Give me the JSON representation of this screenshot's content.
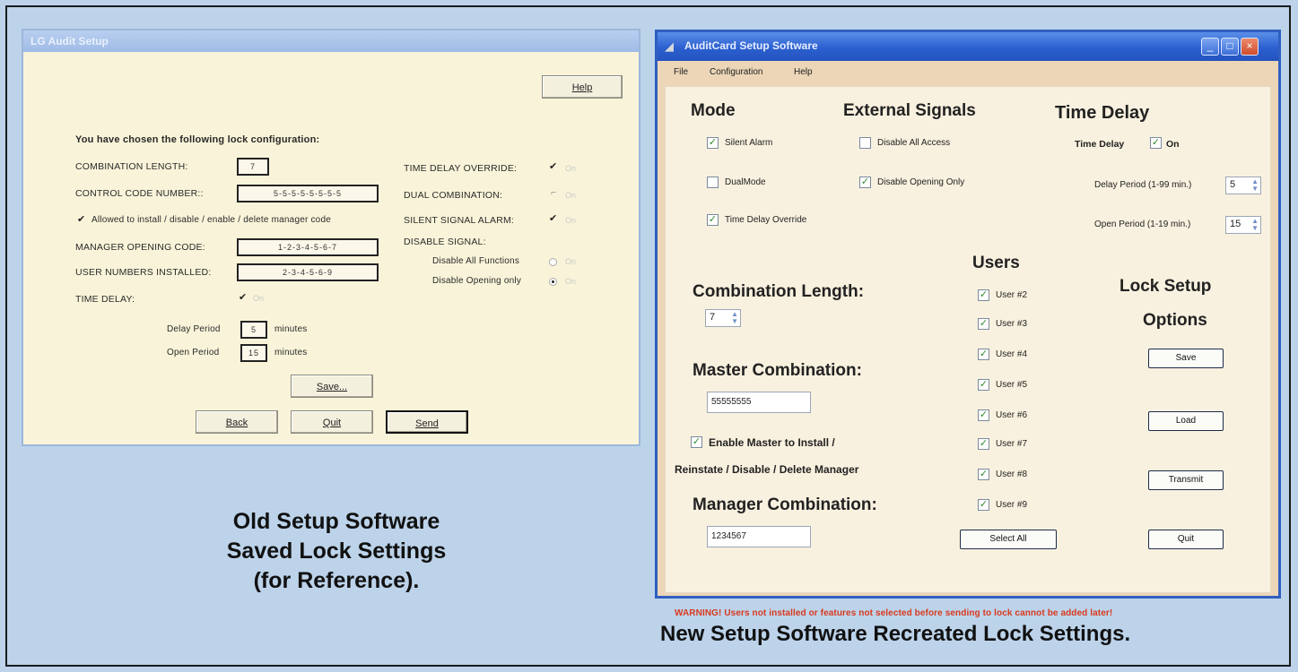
{
  "old": {
    "title": "LG Audit Setup",
    "help": "Help",
    "heading": "You have chosen the following lock configuration:",
    "combination_length_label": "COMBINATION LENGTH:",
    "combination_length": "7",
    "control_code_label": "CONTROL CODE NUMBER::",
    "control_code": "5-5-5-5-5-5-5-5",
    "allowed_label": "Allowed to install / disable / enable / delete manager code",
    "manager_code_label": "MANAGER OPENING CODE:",
    "manager_code": "1-2-3-4-5-6-7",
    "users_label": "USER NUMBERS INSTALLED:",
    "users": "2-3-4-5-6-9",
    "time_delay_label": "TIME DELAY:",
    "on_word": "On",
    "delay_period_label": "Delay Period",
    "delay_period": "5",
    "open_period_label": "Open Period",
    "open_period": "15",
    "minutes": "minutes",
    "tdo_label": "TIME DELAY OVERRIDE:",
    "dual_label": "DUAL COMBINATION:",
    "silent_label": "SILENT SIGNAL ALARM:",
    "disable_signal_label": "DISABLE SIGNAL:",
    "disable_all_label": "Disable All Functions",
    "disable_opening_label": "Disable Opening only",
    "save": "Save...",
    "back": "Back",
    "quit": "Quit",
    "send": "Send",
    "checkmark": "✔"
  },
  "caption_old": [
    "Old Setup Software",
    "Saved Lock Settings",
    "(for Reference)."
  ],
  "new": {
    "title": "AuditCard Setup Software",
    "menu": [
      "File",
      "Configuration",
      "Help"
    ],
    "mode_heading": "Mode",
    "external_heading": "External Signals",
    "time_delay_heading": "Time Delay",
    "silent_alarm": "Silent Alarm",
    "dual_mode": "DualMode",
    "time_delay_override": "Time Delay Override",
    "disable_all_access": "Disable All Access",
    "disable_opening_only": "Disable Opening Only",
    "time_delay_label": "Time Delay",
    "on": "On",
    "delay_period_label": "Delay Period (1-99 min.)",
    "delay_period": "5",
    "open_period_label": "Open Period (1-19 min.)",
    "open_period": "15",
    "users_heading": "Users",
    "users": [
      "User #2",
      "User #3",
      "User #4",
      "User #5",
      "User #6",
      "User #7",
      "User #8",
      "User #9"
    ],
    "select_all": "Select All",
    "combination_length_heading": "Combination Length:",
    "combination_length": "7",
    "master_heading": "Master Combination:",
    "master_value": "55555555",
    "enable_master_line1": "Enable Master to Install /",
    "enable_master_line2": "Reinstate / Disable / Delete Manager",
    "manager_heading": "Manager Combination:",
    "manager_value": "1234567",
    "lock_setup_line1": "Lock Setup",
    "lock_setup_line2": "Options",
    "save": "Save",
    "load": "Load",
    "transmit": "Transmit",
    "quit": "Quit",
    "warning": "WARNING! Users not installed or features not selected before sending to lock cannot be added later!",
    "check": "✓"
  },
  "caption_new": "New Setup Software Recreated Lock Settings."
}
